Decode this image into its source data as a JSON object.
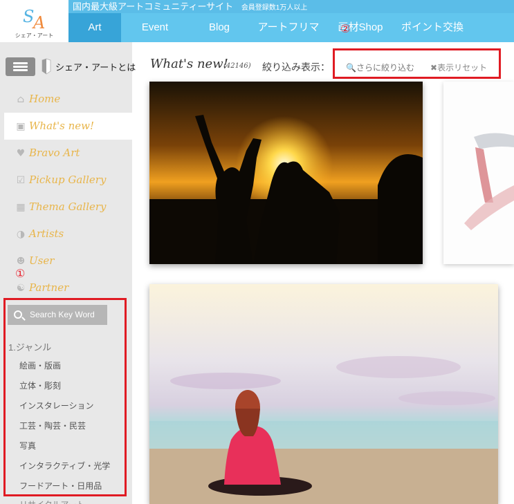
{
  "logo": {
    "mark": "SA",
    "caption": "シェア・アート"
  },
  "topbar": {
    "title": "国内最大級アートコミュニティーサイト",
    "subtitle": "会員登録数1万人以上"
  },
  "nav": {
    "items": [
      "Art",
      "Event",
      "Blog",
      "アートフリマ",
      "画材Shop",
      "ポイント交換"
    ],
    "active": "Art"
  },
  "sidebar": {
    "about": "シェア・アートとは",
    "items": [
      {
        "label": "Home",
        "icon": "home-icon"
      },
      {
        "label": "What's new!",
        "icon": "image-icon"
      },
      {
        "label": "Bravo Art",
        "icon": "heart-icon"
      },
      {
        "label": "Pickup Gallery",
        "icon": "checkbox-icon"
      },
      {
        "label": "Thema Gallery",
        "icon": "picture-icon"
      },
      {
        "label": "Artists",
        "icon": "palette-icon"
      },
      {
        "label": "User",
        "icon": "user-icon"
      },
      {
        "label": "Partner",
        "icon": "handshake-icon"
      }
    ],
    "search_label": "Search Key Word",
    "genre_title": "1.ジャンル",
    "genres": [
      "絵画・版画",
      "立体・彫刻",
      "インスタレーション",
      "工芸・陶芸・民芸",
      "写真",
      "インタラクティブ・光学",
      "フードアート・日用品"
    ],
    "genre_cut": "リサイクルアート"
  },
  "main": {
    "title": "What's new!",
    "count": "(42146)",
    "filter_label": "絞り込み表示：",
    "refine_label": "さらに絞り込む",
    "reset_label": "表示リセット"
  },
  "annotations": {
    "one": "①",
    "two": "②"
  },
  "colors": {
    "nav": "#62c6ee",
    "nav_active": "#37a4d8",
    "topbar": "#5bbde8",
    "sidebar_text": "#e8b54a",
    "highlight": "#e01b23"
  }
}
